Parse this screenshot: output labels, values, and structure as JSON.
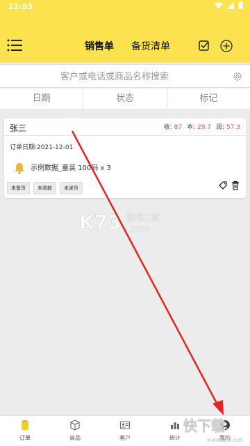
{
  "status_bar": {
    "time": "11:53"
  },
  "header": {
    "tabs": [
      {
        "label": "销售单",
        "active": true
      },
      {
        "label": "备货清单",
        "active": false
      }
    ]
  },
  "search": {
    "placeholder": "客户或电话或商品名称搜索"
  },
  "filters": [
    "日期",
    "状态",
    "标记"
  ],
  "order": {
    "customer": "张三",
    "income_label": "收:",
    "income": "87",
    "cost_label": "本:",
    "cost": "29.7",
    "profit_label": "润:",
    "profit": "57.3",
    "date_text": "订单日期:2021-12-01",
    "item_text": "示例数据_童装 100码 x 3",
    "tags": [
      "未备货",
      "未收款",
      "未发货"
    ]
  },
  "watermark": {
    "brand": "K73",
    "cn": "游戏之家",
    "domain": ".com",
    "corner_text": "快下载",
    "corner_url": "www.kkx.net"
  },
  "bottom_nav": [
    {
      "label": "订单",
      "icon": "order-icon",
      "active": true
    },
    {
      "label": "商品",
      "icon": "box-icon",
      "active": false
    },
    {
      "label": "客户",
      "icon": "contact-icon",
      "active": false
    },
    {
      "label": "统计",
      "icon": "chart-icon",
      "active": false
    },
    {
      "label": "我的",
      "icon": "user-icon",
      "active": false
    }
  ],
  "colors": {
    "header": "#fde24f",
    "accent_red": "#e0564f",
    "arrow": "#e8231f"
  }
}
